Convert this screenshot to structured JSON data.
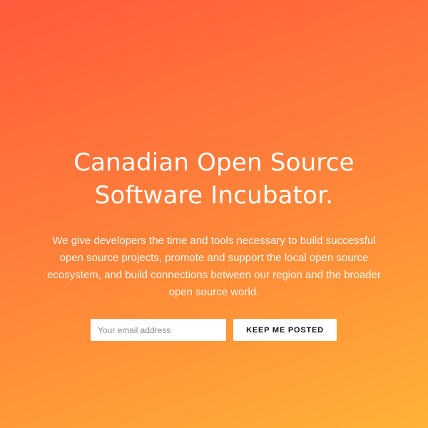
{
  "hero": {
    "title_line_1": "Canadian Open Source",
    "title_line_2": "Software Incubator.",
    "description": "We give developers the time and tools necessary to build successful open source projects, promote and support the local open source ecosystem, and build connections between our region and the broader open source world."
  },
  "signup": {
    "email_placeholder": "Your email address",
    "email_value": "",
    "submit_label": "KEEP ME POSTED"
  },
  "colors": {
    "gradient_start": "#ff5a3c",
    "gradient_end": "#ffb236",
    "text": "#ffffff"
  }
}
